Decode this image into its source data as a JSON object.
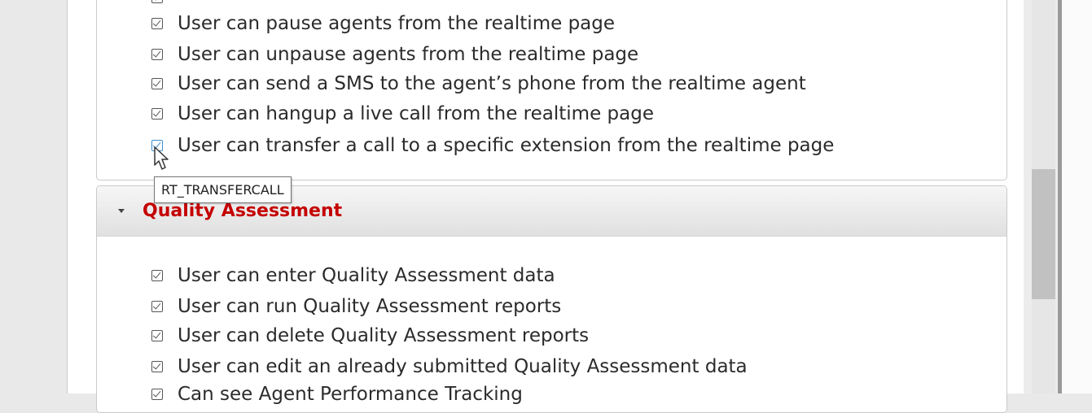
{
  "realtime_permissions": [
    {
      "label": "User can pause agents from the realtime page",
      "checked": true
    },
    {
      "label": "User can unpause agents from the realtime page",
      "checked": true
    },
    {
      "label": "User can send a SMS to the agent’s phone from the realtime agent",
      "checked": true
    },
    {
      "label": "User can hangup a live call from the realtime page",
      "checked": true
    },
    {
      "label": "User can transfer a call to a specific extension from the realtime page",
      "checked": true
    }
  ],
  "tooltip": {
    "text": "RT_TRANSFERCALL"
  },
  "quality_section": {
    "title": "Quality Assessment",
    "permissions": [
      {
        "label": "User can enter Quality Assessment data",
        "checked": true
      },
      {
        "label": "User can run Quality Assessment reports",
        "checked": true
      },
      {
        "label": "User can delete Quality Assessment reports",
        "checked": true
      },
      {
        "label": "User can edit an already submitted Quality Assessment data",
        "checked": true
      },
      {
        "label": "Can see Agent Performance Tracking",
        "checked": true
      }
    ]
  },
  "colors": {
    "section_title": "#c50000",
    "hover_checkbox": "#3a8fd0"
  }
}
